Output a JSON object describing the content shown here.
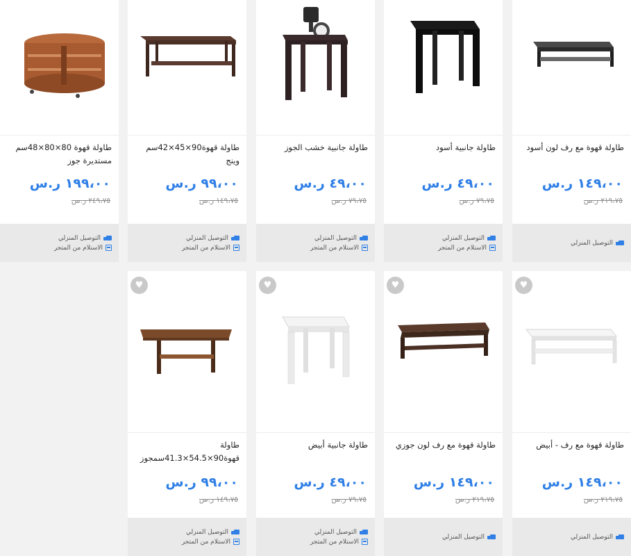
{
  "products": [
    {
      "title": "طاولة قهوة 80×80×48سم مستديرة جوز",
      "price": "١٩٩،٠٠ ر.س",
      "old_price": "٢٤٩،٧٥ ر.س",
      "delivery": [
        "التوصيل المنزلي",
        "الاستلام من المتجر"
      ]
    },
    {
      "title": "طاولة قهوة90×45×42سم وينج",
      "price": "٩٩،٠٠ ر.س",
      "old_price": "١٤٩،٧٥ ر.س",
      "delivery": [
        "التوصيل المنزلي",
        "الاستلام من المتجر"
      ]
    },
    {
      "title": "طاولة جانبية خشب الجوز",
      "price": "٤٩،٠٠ ر.س",
      "old_price": "٧٩،٧٥ ر.س",
      "delivery": [
        "التوصيل المنزلي",
        "الاستلام من المتجر"
      ]
    },
    {
      "title": "طاولة جانبية أسود",
      "price": "٤٩،٠٠ ر.س",
      "old_price": "٧٩،٧٥ ر.س",
      "delivery": [
        "التوصيل المنزلي",
        "الاستلام من المتجر"
      ]
    },
    {
      "title": "طاولة قهوة مع رف لون أسود",
      "price": "١٤٩،٠٠ ر.س",
      "old_price": "٢١٩،٧٥ ر.س",
      "delivery": [
        "التوصيل المنزلي"
      ]
    },
    {
      "title": "طاولة قهوة90×54.5×41.3سمجوز",
      "price": "٩٩،٠٠ ر.س",
      "old_price": "١٤٩،٧٥ ر.س",
      "delivery": [
        "التوصيل المنزلي",
        "الاستلام من المتجر"
      ]
    },
    {
      "title": "طاولة جانبية أبيض",
      "price": "٤٩،٠٠ ر.س",
      "old_price": "٧٩،٧٥ ر.س",
      "delivery": [
        "التوصيل المنزلي",
        "الاستلام من المتجر"
      ]
    },
    {
      "title": "طاولة قهوة مع رف لون جوزي",
      "price": "١٤٩،٠٠ ر.س",
      "old_price": "٢١٩،٧٥ ر.س",
      "delivery": [
        "التوصيل المنزلي"
      ]
    },
    {
      "title": "طاولة قهوة مع رف - أبيض",
      "price": "١٤٩،٠٠ ر.س",
      "old_price": "٢١٩،٧٥ ر.س",
      "delivery": [
        "التوصيل المنزلي"
      ]
    }
  ],
  "icons": {
    "favorite": "heart-icon",
    "delivery": "truck-icon",
    "pickup": "store-icon"
  },
  "colors": {
    "price": "#2f7fe6",
    "accent": "#2f7fe6"
  }
}
